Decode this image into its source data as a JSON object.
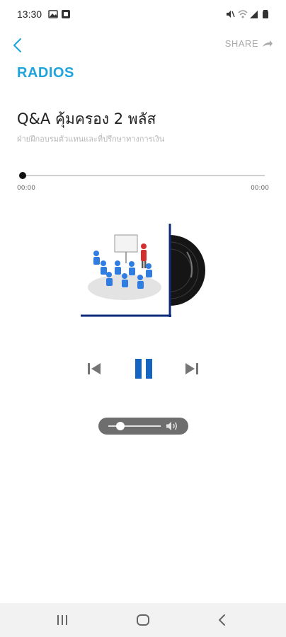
{
  "status_bar": {
    "time": "13:30",
    "left_icons": [
      "gallery-icon",
      "app-notification-icon"
    ],
    "right_icons": [
      "mute-icon",
      "wifi-icon",
      "signal-icon",
      "battery-icon"
    ]
  },
  "top_bar": {
    "back_icon": "chevron-left-icon",
    "share_label": "SHARE",
    "share_icon": "share-arrow-icon"
  },
  "page": {
    "title": "RADIOS",
    "accent_color": "#1ea3dd"
  },
  "episode": {
    "title": "Q&A คุ้มครอง 2 พลัส",
    "subtitle": "ฝ่ายฝึกอบรมตัวแทนและที่ปรึกษาทางการเงิน"
  },
  "player": {
    "current_time": "00:00",
    "total_time": "00:00",
    "progress": 0,
    "state": "playing",
    "controls": [
      "previous-icon",
      "pause-icon",
      "next-icon"
    ],
    "control_color": "#1565c0",
    "volume_level": 0.15
  },
  "artwork": {
    "icons": [
      "presentation-icon",
      "vinyl-record-icon"
    ]
  },
  "nav_bar": {
    "buttons": [
      "recent-apps-icon",
      "home-icon",
      "back-icon"
    ]
  }
}
